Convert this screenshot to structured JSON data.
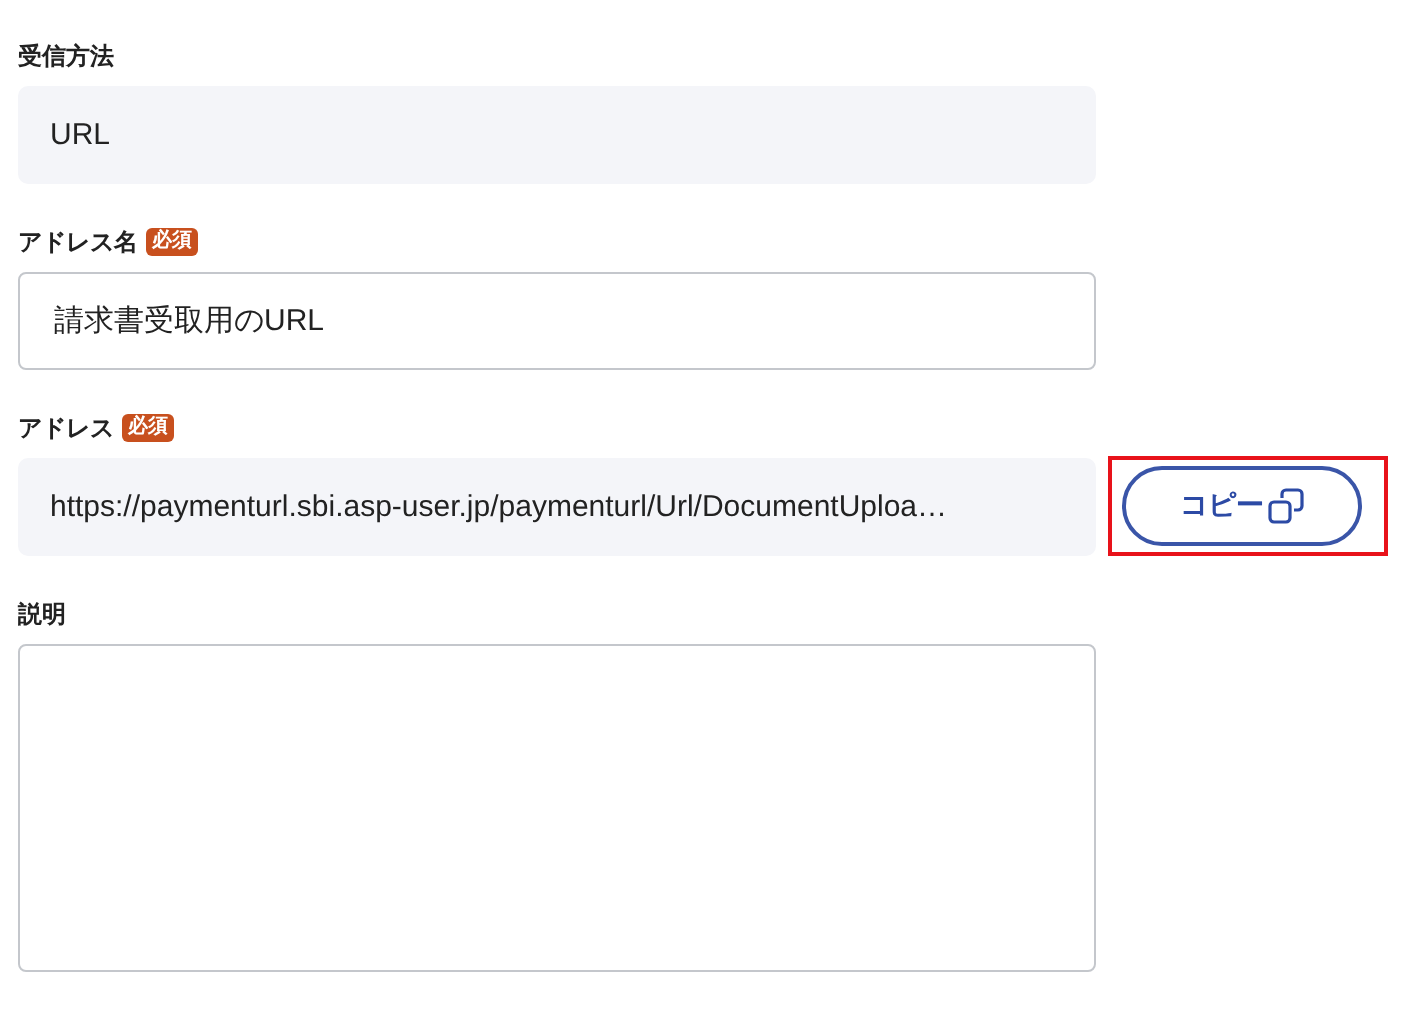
{
  "fields": [
    {
      "kind": "readonly",
      "label": "受信方法",
      "value": "URL"
    },
    {
      "kind": "input",
      "label": "アドレス名",
      "required_badge": "必須",
      "value": "請求書受取用のURL"
    },
    {
      "kind": "copy",
      "label": "アドレス",
      "required_badge": "必須",
      "value": "https://paymenturl.sbi.asp-user.jp/paymenturl/Url/DocumentUploa…",
      "button": {
        "label": "コピー",
        "highlighted": true
      }
    },
    {
      "kind": "textarea",
      "label": "説明"
    }
  ]
}
